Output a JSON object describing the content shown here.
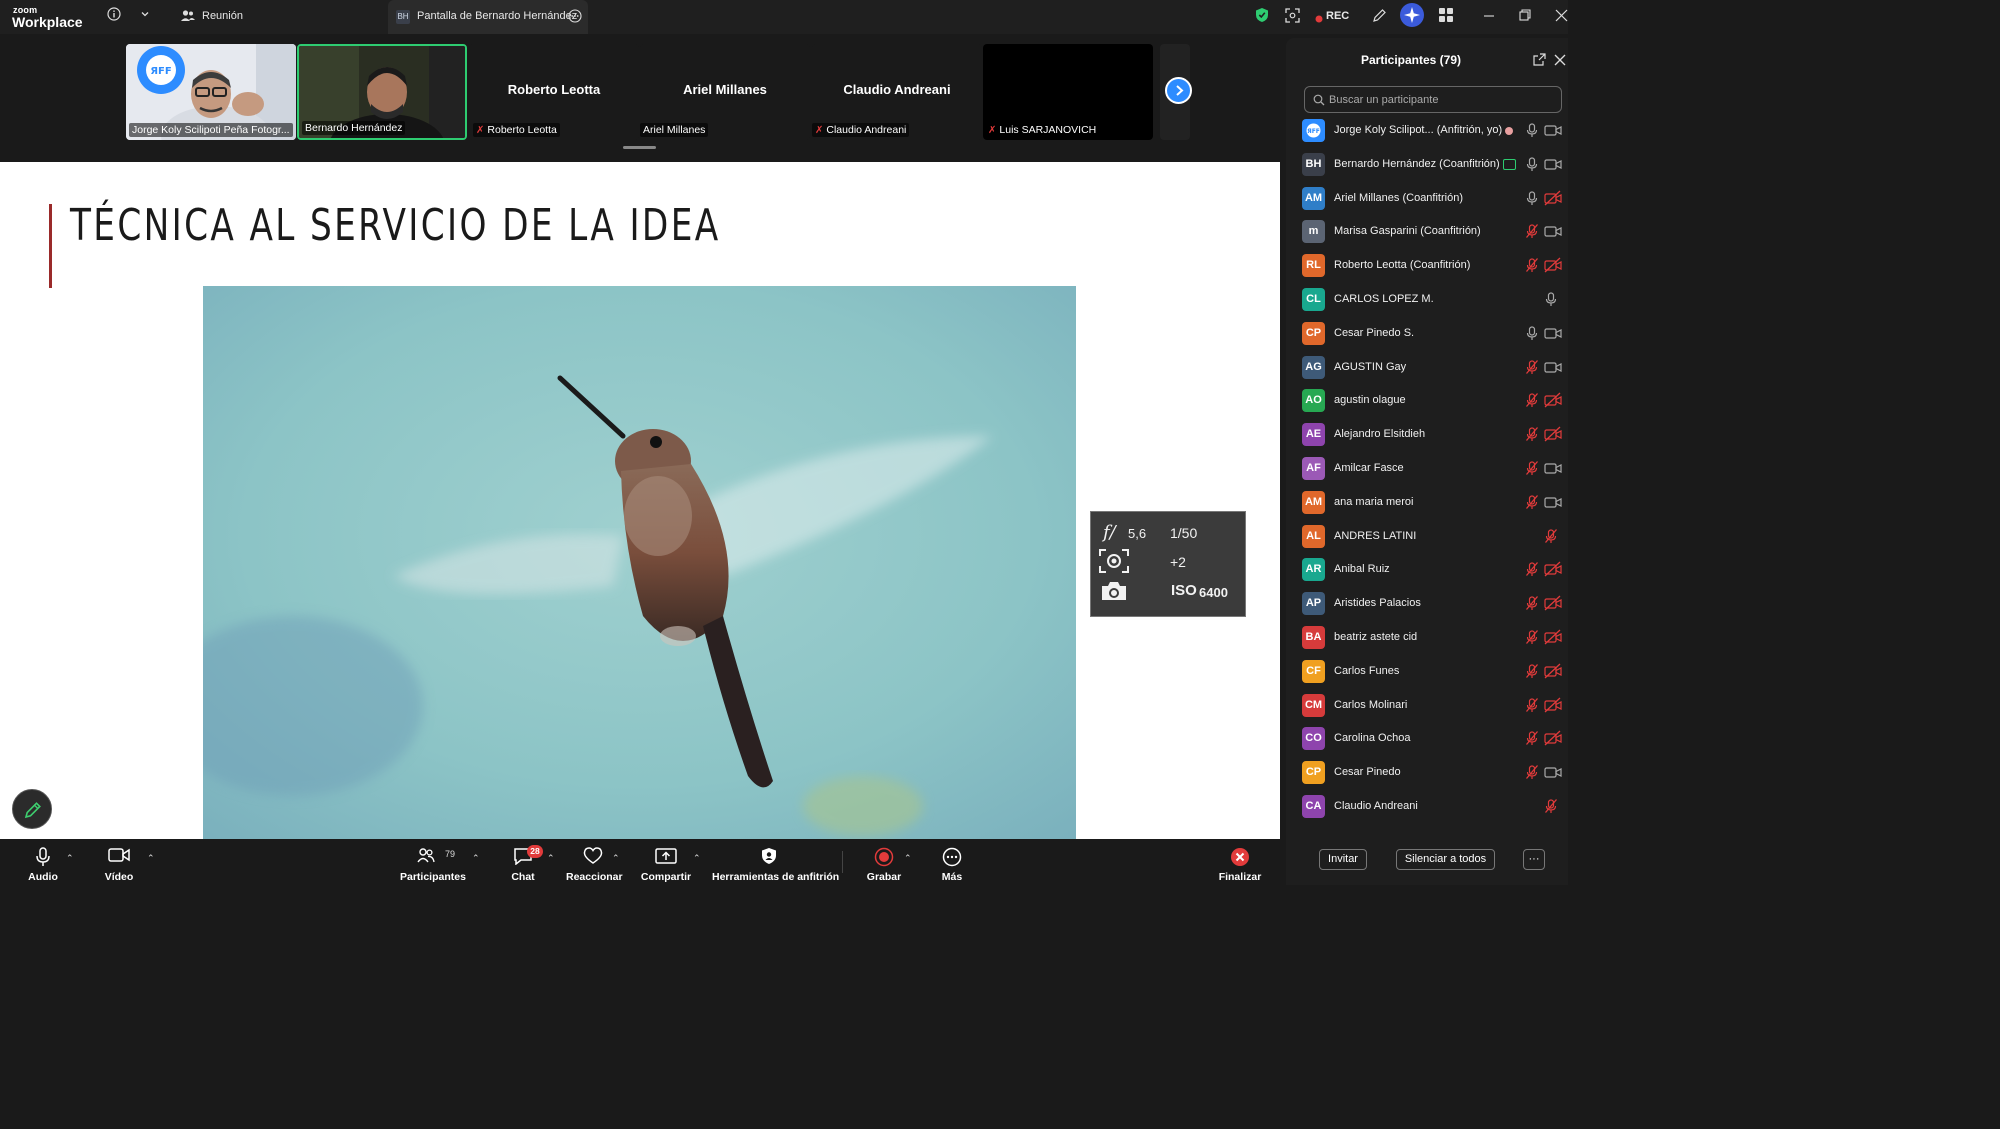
{
  "app": {
    "logo_top": "zoom",
    "logo_bottom": "Workplace",
    "meeting_label": "Reunión",
    "share_tab_chip": "BH",
    "share_tab_label": "Pantalla de Bernardo Hernández",
    "rec_label": "REC"
  },
  "video_strip": {
    "tiles": [
      {
        "name": "Jorge Koly Scilipoti Peña Fotogr...",
        "type": "video"
      },
      {
        "name": "Bernardo Hernández",
        "type": "video",
        "active_speaker": true
      },
      {
        "name": "Roberto Leotta",
        "big_name": "Roberto Leotta",
        "muted": true
      },
      {
        "name": "Ariel Millanes",
        "big_name": "Ariel Millanes",
        "muted": false
      },
      {
        "name": "Claudio Andreani",
        "big_name": "Claudio Andreani",
        "muted": true
      },
      {
        "name": "Luis SARJANOVICH",
        "muted": true
      }
    ]
  },
  "slide": {
    "title": "TÉCNICA AL SERVICIO DE LA IDEA",
    "exif": {
      "aperture_symbol": "f/",
      "aperture": "5,6",
      "shutter": "1/50",
      "exposure_comp": "+2",
      "iso_label": "ISO",
      "iso_value": "6400"
    }
  },
  "participants_panel": {
    "title": "Participantes (79)",
    "search_placeholder": "Buscar un participante",
    "invite_label": "Invitar",
    "mute_all_label": "Silenciar a todos",
    "more_label": "···",
    "participants": [
      {
        "initials": "",
        "name": "Jorge Koly Scilipot... (Anfitrión, yo)",
        "color": "#2d8cff",
        "mic": "on",
        "cam": "on"
      },
      {
        "initials": "BH",
        "name": "Bernardo Hernández (Coanfitrión)",
        "color": "#3a3f4a",
        "mic": "on",
        "cam": "on"
      },
      {
        "initials": "AM",
        "name": "Ariel Millanes (Coanfitrión)",
        "color": "#2f7ec8",
        "mic": "on",
        "cam": "off"
      },
      {
        "initials": "m",
        "name": "Marisa Gasparini (Coanfitrión)",
        "color": "#5b6473",
        "mic": "off",
        "cam": "on"
      },
      {
        "initials": "RL",
        "name": "Roberto Leotta (Coanfitrión)",
        "color": "#e0682b",
        "mic": "off",
        "cam": "off"
      },
      {
        "initials": "CL",
        "name": "CARLOS LOPEZ M.",
        "color": "#19a88f",
        "mic": "on",
        "cam": "none"
      },
      {
        "initials": "CP",
        "name": "Cesar Pinedo S.",
        "color": "#e0682b",
        "mic": "on",
        "cam": "on"
      },
      {
        "initials": "AG",
        "name": "AGUSTIN Gay",
        "color": "#3e5a78",
        "mic": "off",
        "cam": "on"
      },
      {
        "initials": "AO",
        "name": "agustin olague",
        "color": "#27a852",
        "mic": "off",
        "cam": "off"
      },
      {
        "initials": "AE",
        "name": "Alejandro Elsitdieh",
        "color": "#8e44ad",
        "mic": "off",
        "cam": "off"
      },
      {
        "initials": "AF",
        "name": "Amilcar Fasce",
        "color": "#9b59b6",
        "mic": "off",
        "cam": "on"
      },
      {
        "initials": "AM",
        "name": "ana maria meroi",
        "color": "#e0682b",
        "mic": "off",
        "cam": "on"
      },
      {
        "initials": "AL",
        "name": "ANDRES LATINI",
        "color": "#e0682b",
        "mic": "off",
        "cam": "none"
      },
      {
        "initials": "AR",
        "name": "Anibal Ruiz",
        "color": "#19a88f",
        "mic": "off",
        "cam": "off"
      },
      {
        "initials": "AP",
        "name": "Aristides Palacios",
        "color": "#3e5a78",
        "mic": "off",
        "cam": "off"
      },
      {
        "initials": "BA",
        "name": "beatriz astete cid",
        "color": "#d63b3b",
        "mic": "off",
        "cam": "off"
      },
      {
        "initials": "CF",
        "name": "Carlos Funes",
        "color": "#f0a020",
        "mic": "off",
        "cam": "off"
      },
      {
        "initials": "CM",
        "name": "Carlos Molinari",
        "color": "#d63b3b",
        "mic": "off",
        "cam": "off"
      },
      {
        "initials": "CO",
        "name": "Carolina Ochoa",
        "color": "#8e44ad",
        "mic": "off",
        "cam": "off"
      },
      {
        "initials": "CP",
        "name": "Cesar Pinedo",
        "color": "#f0a020",
        "mic": "off",
        "cam": "on"
      },
      {
        "initials": "CA",
        "name": "Claudio Andreani",
        "color": "#8e44ad",
        "mic": "off",
        "cam": "none"
      }
    ]
  },
  "toolbar": {
    "audio": "Audio",
    "video": "Vídeo",
    "participants": "Participantes",
    "participants_count": "79",
    "chat": "Chat",
    "chat_badge": "28",
    "react": "Reaccionar",
    "share": "Compartir",
    "host_tools": "Herramientas de anfitrión",
    "record": "Grabar",
    "more": "Más",
    "end": "Finalizar"
  },
  "colors": {
    "accent": "#2d8cff",
    "danger": "#e23b3b",
    "active_speaker": "#2ecc71"
  }
}
